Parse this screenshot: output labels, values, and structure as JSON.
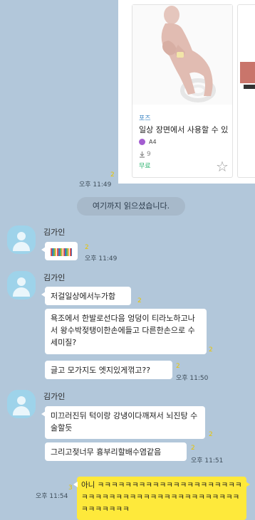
{
  "card": {
    "tag": "포즈",
    "title": "일상 장면에서 사용할 수 있",
    "author": "A4",
    "downloads": "9",
    "price": "무료"
  },
  "card_message": {
    "unread": "2",
    "time": "오후 11:49"
  },
  "notice": "여기까지 읽으셨습니다.",
  "groups": [
    {
      "name": "김가인",
      "messages": [
        {
          "text": "",
          "censored": true,
          "unread": "2",
          "time": "오후 11:49"
        }
      ]
    },
    {
      "name": "김가인",
      "messages": [
        {
          "text": "저걸일상에서누가함",
          "unread": "2"
        },
        {
          "text": "욕조에서 한발로선다음 엉덩이 티라노하고나서 왕수박젖탱이한손에들고 다른한손으로 수세미질?",
          "unread": "2"
        },
        {
          "text": "글고 모가지도 엣지있게꺾고??",
          "unread": "2",
          "time": "오후 11:50"
        }
      ]
    },
    {
      "name": "김가인",
      "messages": [
        {
          "text": "미끄러진뒤 턱이랑 강냉이다깨져서 뇌진탕 수술할듯",
          "unread": "2"
        },
        {
          "text": "그리고젖너무 흉부리할배수염같음",
          "unread": "2",
          "time": "오후 11:51"
        }
      ]
    }
  ],
  "my_message": {
    "text": "아니 ㅋㅋㅋㅋㅋㅋㅋㅋㅋㅋㅋㅋㅋㅋㅋㅋㅋㅋㅋㅋㅋㅋㅋㅋㅋㅋㅋㅋㅋㅋㅋㅋㅋㅋㅋㅋㅋㅋㅋㅋㅋㅋㅋㅋㅋㅋㅋㅋㅋㅋㅋ",
    "unread": "3",
    "time": "오후 11:54"
  },
  "colors": {
    "background": "#b2c7da",
    "my_bubble": "#fee93b",
    "other_bubble": "#ffffff",
    "unread": "#e9c400",
    "avatar": "#9ed3ea"
  },
  "icons": [
    "download-icon",
    "star-icon",
    "default-profile-icon"
  ]
}
